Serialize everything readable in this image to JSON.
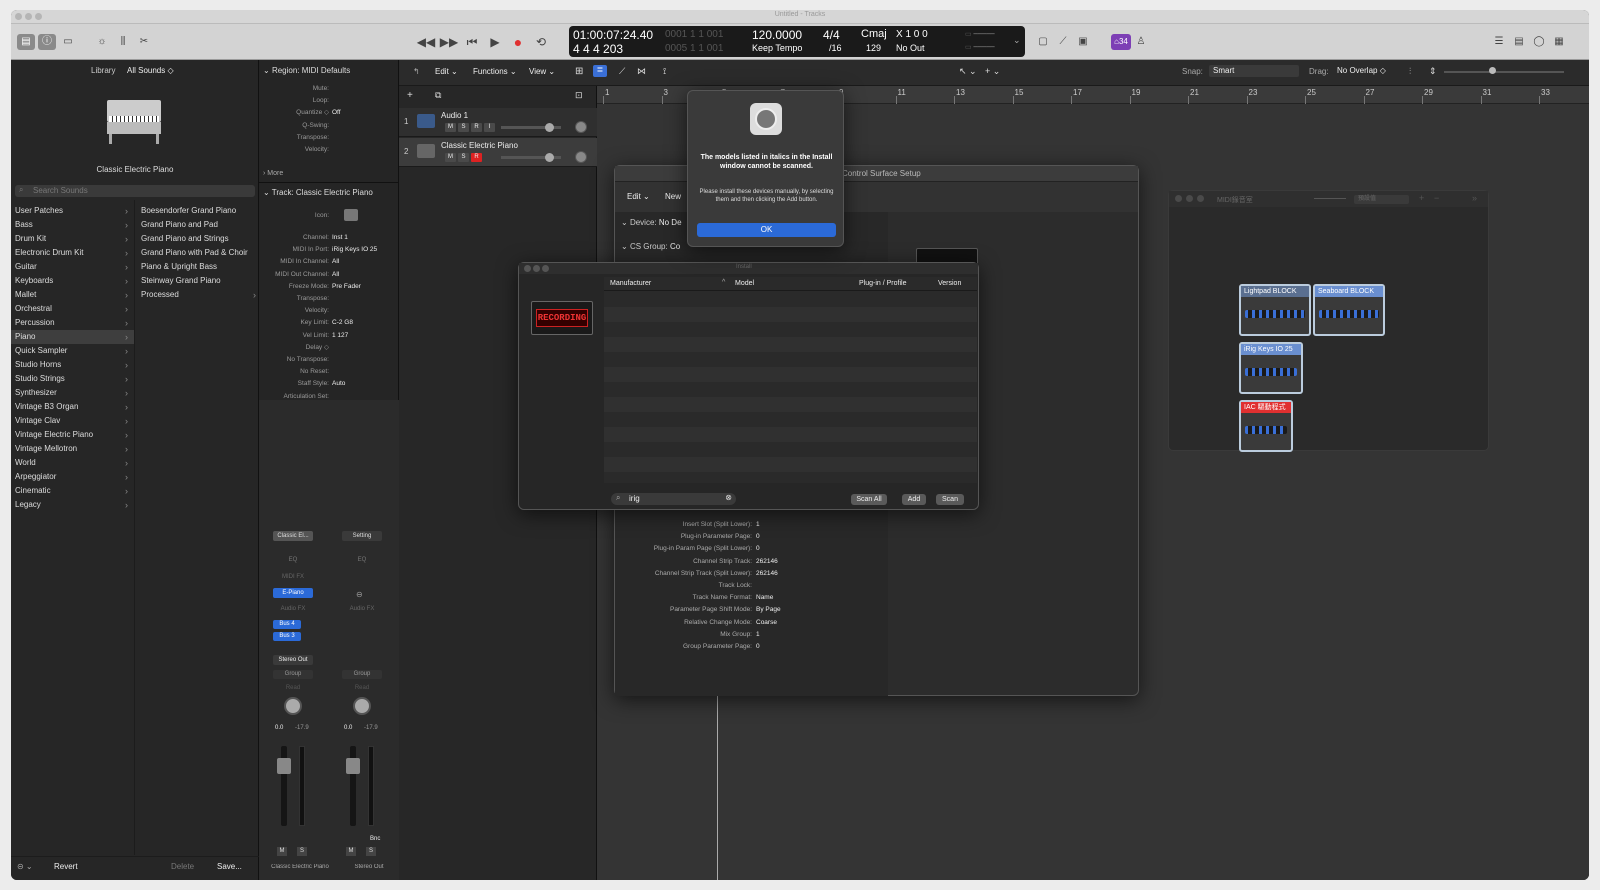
{
  "window": {
    "title": "Untitled - Tracks"
  },
  "transport": {
    "position_smpte": "01:00:07:24.40",
    "position_bars": "4 4 4 203",
    "dim_line1": "0001 1 1 001",
    "dim_line2": "0005 1 1 001",
    "tempo": "120.0000",
    "tempo_mode": "Keep Tempo",
    "signature": "4/4",
    "division": "/16",
    "key": "Cmaj",
    "in_count": "129",
    "in_label": "X 1 0 0",
    "out": "No Out",
    "badge": "⌂34"
  },
  "library": {
    "label": "Library",
    "selector": "All Sounds ◇",
    "patch_name": "Classic Electric Piano",
    "search_placeholder": "Search Sounds",
    "categories": [
      "User Patches",
      "Bass",
      "Drum Kit",
      "Electronic Drum Kit",
      "Guitar",
      "Keyboards",
      "Mallet",
      "Orchestral",
      "Percussion",
      "Piano",
      "Quick Sampler",
      "Studio Horns",
      "Studio Strings",
      "Synthesizer",
      "Vintage B3 Organ",
      "Vintage Clav",
      "Vintage Electric Piano",
      "Vintage Mellotron",
      "World",
      "Arpeggiator",
      "Cinematic",
      "Legacy"
    ],
    "selected_index": 9,
    "patches": [
      "Boesendorfer Grand Piano",
      "Grand Piano and Pad",
      "Grand Piano and Strings",
      "Grand Piano with Pad & Choir",
      "Piano & Upright Bass",
      "Steinway Grand Piano",
      "Processed"
    ],
    "footer": {
      "revert": "Revert",
      "delete": "Delete",
      "save": "Save..."
    }
  },
  "inspector": {
    "region_header": "Region: MIDI Defaults",
    "region_rows": [
      {
        "label": "Mute:",
        "value": ""
      },
      {
        "label": "Loop:",
        "value": ""
      },
      {
        "label": "Quantize ◇",
        "value": "Off"
      },
      {
        "label": "Q-Swing:",
        "value": ""
      },
      {
        "label": "Transpose:",
        "value": ""
      },
      {
        "label": "Velocity:",
        "value": ""
      }
    ],
    "more": "More",
    "track_header": "Track: Classic Electric Piano",
    "track_rows": [
      {
        "label": "Icon:",
        "value": ""
      },
      {
        "label": "Channel:",
        "value": "Inst 1"
      },
      {
        "label": "MIDI In Port:",
        "value": "iRig Keys IO 25"
      },
      {
        "label": "MIDI In Channel:",
        "value": "All"
      },
      {
        "label": "MIDI Out Channel:",
        "value": "All"
      },
      {
        "label": "Freeze Mode:",
        "value": "Pre Fader"
      },
      {
        "label": "Transpose:",
        "value": ""
      },
      {
        "label": "Velocity:",
        "value": ""
      },
      {
        "label": "Key Limit:",
        "value": "C-2  G8"
      },
      {
        "label": "Vel Limit:",
        "value": "1  127"
      },
      {
        "label": "Delay ◇",
        "value": ""
      },
      {
        "label": "No Transpose:",
        "value": ""
      },
      {
        "label": "No Reset:",
        "value": ""
      },
      {
        "label": "Staff Style:",
        "value": "Auto"
      },
      {
        "label": "Articulation Set:",
        "value": ""
      }
    ],
    "strip1": {
      "name": "Classic El...",
      "eq": "EQ",
      "midi_fx": "MIDI FX",
      "plugin": "E-Piano",
      "audio_fx": "Audio FX",
      "bus1": "Bus 4",
      "bus2": "Bus 3",
      "output": "Stereo Out",
      "group": "Group",
      "auto": "Read",
      "pan": "0.0",
      "level": "-17.9",
      "m": "M",
      "s": "S",
      "footer": "Classic Electric Piano"
    },
    "strip2": {
      "name": "Setting",
      "eq": "EQ",
      "audio_fx": "Audio FX",
      "group": "Group",
      "auto": "Read",
      "pan": "0.0",
      "level": "-17.9",
      "bnc": "Bnc",
      "m": "M",
      "s": "S",
      "footer": "Stereo Out"
    }
  },
  "tracks_area": {
    "menu": {
      "edit": "Edit",
      "functions": "Functions",
      "view": "View"
    },
    "snap_label": "Snap:",
    "snap_value": "Smart",
    "drag_label": "Drag:",
    "drag_value": "No Overlap",
    "ruler": [
      "1",
      "3",
      "5",
      "7",
      "9",
      "11",
      "13",
      "15",
      "17",
      "19",
      "21",
      "23",
      "25",
      "27",
      "29",
      "31",
      "33"
    ],
    "tracks": [
      {
        "num": "1",
        "name": "Audio 1",
        "buttons": [
          "M",
          "S",
          "R",
          "I"
        ]
      },
      {
        "num": "2",
        "name": "Classic Electric Piano",
        "buttons": [
          "M",
          "S",
          "R"
        ]
      }
    ]
  },
  "alert": {
    "title": "The models listed in italics in the Install window cannot be scanned.",
    "body": "Please install these devices manually, by selecting them and then clicking the Add button.",
    "ok": "OK"
  },
  "cs_setup": {
    "title": "Control Surface Setup",
    "menu_edit": "Edit",
    "menu_new": "New",
    "device_label": "Device:",
    "device_value": "No De",
    "csgroup_label": "CS Group:",
    "csgroup_value": "Co",
    "rows": [
      {
        "label": "Insert Slot (Split Lower):",
        "value": "1"
      },
      {
        "label": "Plug-in Parameter Page:",
        "value": "0"
      },
      {
        "label": "Plug-in Param Page (Split Lower):",
        "value": "0"
      },
      {
        "label": "Channel Strip Track:",
        "value": "262146"
      },
      {
        "label": "Channel Strip Track (Split Lower):",
        "value": "262146"
      },
      {
        "label": "Track Lock:",
        "value": ""
      },
      {
        "label": "Track Name Format:",
        "value": "Name"
      },
      {
        "label": "Parameter Page Shift Mode:",
        "value": "By Page"
      },
      {
        "label": "Relative Change Mode:",
        "value": "Coarse"
      },
      {
        "label": "Mix Group:",
        "value": "1"
      },
      {
        "label": "Group Parameter Page:",
        "value": "0"
      }
    ]
  },
  "install": {
    "title": "Install",
    "logo": "RECORDING",
    "columns": [
      "Manufacturer",
      "Model",
      "Plug-in / Profile",
      "Version"
    ],
    "search_value": "irig",
    "buttons": {
      "scan_all": "Scan All",
      "add": "Add",
      "scan": "Scan"
    }
  },
  "midi_studio": {
    "title": "MIDI錄音室",
    "preset": "預設值",
    "devices": [
      {
        "name": "Lightpad BLOCK",
        "color": "#5a6f90"
      },
      {
        "name": "Seaboard BLOCK",
        "color": "#6a8fd0"
      },
      {
        "name": "iRig Keys IO 25",
        "color": "#6a8fd0"
      },
      {
        "name": "IAC 驅動程式",
        "color": "#e03030"
      }
    ]
  }
}
